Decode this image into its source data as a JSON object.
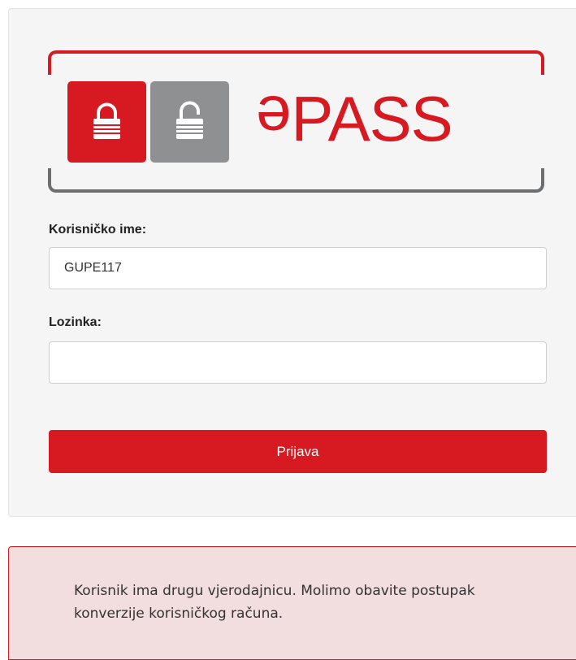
{
  "brand": {
    "name": "ePASS",
    "accent_color": "#d71921",
    "secondary_color": "#6d6e70",
    "icons": [
      "lock-closed-icon",
      "lock-open-icon"
    ]
  },
  "form": {
    "username_label": "Korisničko ime:",
    "username_value": "GUPE117",
    "password_label": "Lozinka:",
    "password_value": "",
    "submit_label": "Prijava"
  },
  "alert": {
    "message": "Korisnik ima drugu vjerodajnicu. Molimo obavite postupak konverzije korisničkog računa."
  }
}
